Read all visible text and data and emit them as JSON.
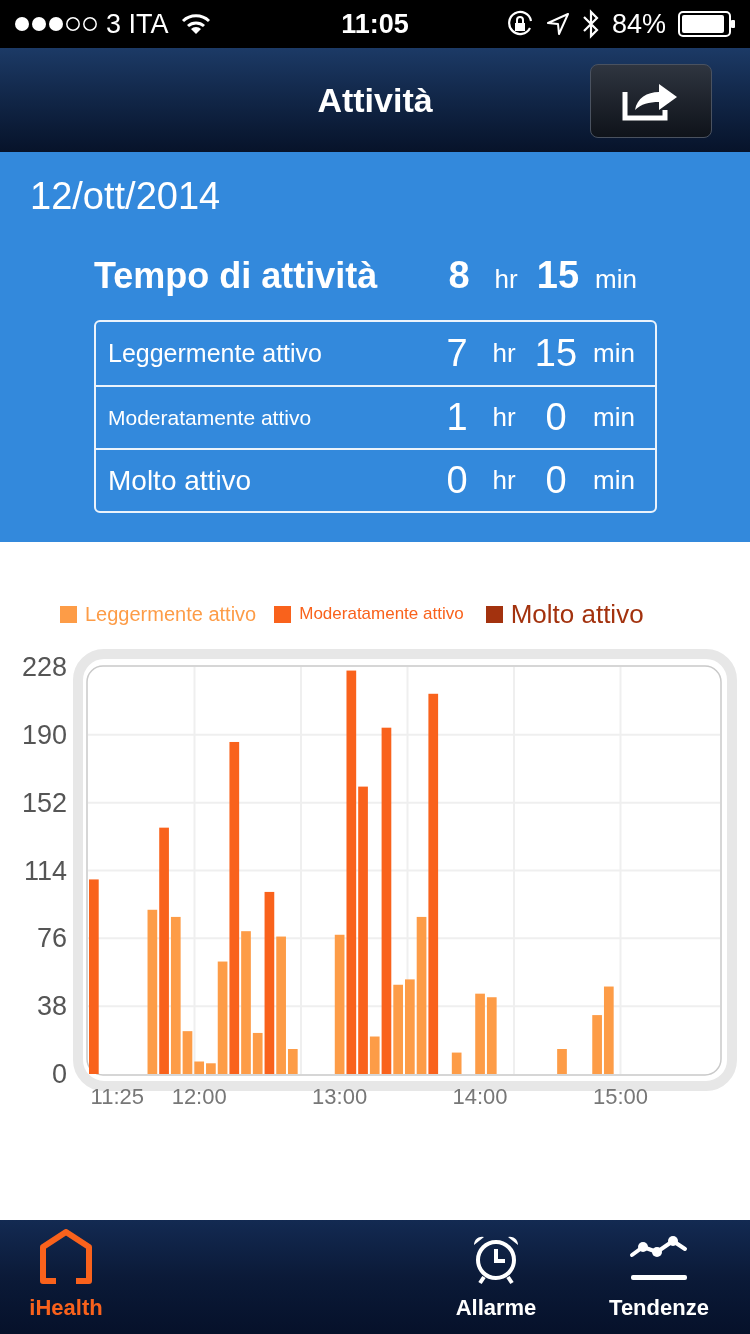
{
  "status_bar": {
    "carrier": "3 ITA",
    "time": "11:05",
    "battery": "84%"
  },
  "nav_bar": {
    "title": "Attività"
  },
  "date": "12/ott/2014",
  "summary": {
    "label": "Tempo di attività",
    "hours": "8",
    "hours_unit": "hr",
    "minutes": "15",
    "minutes_unit": "min"
  },
  "breakdown": [
    {
      "label": "Leggermente attivo",
      "hours": "7",
      "hours_unit": "hr",
      "minutes": "15",
      "minutes_unit": "min"
    },
    {
      "label": "Moderatamente attivo",
      "hours": "1",
      "hours_unit": "hr",
      "minutes": "0",
      "minutes_unit": "min"
    },
    {
      "label": "Molto attivo",
      "hours": "0",
      "hours_unit": "hr",
      "minutes": "0",
      "minutes_unit": "min"
    }
  ],
  "chart": {
    "chart_data": {
      "type": "bar",
      "stacked": true,
      "grid": true,
      "x": [
        675,
        680,
        685,
        690,
        695,
        700,
        705,
        710,
        715,
        720,
        725,
        730,
        735,
        740,
        745,
        750,
        755,
        760,
        765,
        770,
        775,
        780,
        785,
        790,
        795,
        800,
        805,
        810,
        815,
        820,
        825,
        830,
        835,
        840,
        845,
        850,
        855,
        860,
        865,
        870,
        875,
        880,
        885,
        890,
        895,
        900,
        905,
        910,
        915,
        920,
        925,
        930,
        935,
        940
      ],
      "xlim": [
        672.5,
        942.5
      ],
      "series": [
        {
          "name": "Leggermente attivo",
          "color": "#fd9c47",
          "values": [
            0,
            0,
            0,
            0,
            0,
            92,
            0,
            88,
            24,
            7,
            6,
            63,
            0,
            80,
            23,
            0,
            77,
            14,
            0,
            0,
            0,
            78,
            0,
            0,
            21,
            0,
            50,
            53,
            88,
            0,
            0,
            12,
            0,
            45,
            43,
            0,
            0,
            0,
            0,
            0,
            14,
            0,
            0,
            33,
            49,
            0,
            0,
            0,
            0,
            0,
            0,
            0,
            0,
            0
          ]
        },
        {
          "name": "Moderatamente attivo",
          "color": "#f9621c",
          "values": [
            109,
            0,
            0,
            0,
            0,
            0,
            138,
            0,
            0,
            0,
            0,
            0,
            186,
            0,
            0,
            102,
            0,
            0,
            0,
            0,
            0,
            0,
            226,
            161,
            0,
            194,
            0,
            0,
            0,
            213,
            0,
            0,
            0,
            0,
            0,
            0,
            0,
            0,
            0,
            0,
            0,
            0,
            0,
            0,
            0,
            0,
            0,
            0,
            0,
            0,
            0,
            0,
            0,
            0
          ]
        },
        {
          "name": "Molto attivo",
          "color": "#a3320e",
          "values": [
            0,
            0,
            0,
            0,
            0,
            0,
            0,
            0,
            0,
            0,
            0,
            0,
            0,
            0,
            0,
            0,
            0,
            0,
            0,
            0,
            0,
            0,
            0,
            0,
            0,
            0,
            0,
            0,
            0,
            0,
            0,
            0,
            0,
            0,
            0,
            0,
            0,
            0,
            0,
            0,
            0,
            0,
            0,
            0,
            0,
            0,
            0,
            0,
            0,
            0,
            0,
            0,
            0,
            0
          ]
        }
      ],
      "ylim": [
        0,
        228
      ],
      "yticks": [
        0,
        38,
        76,
        114,
        152,
        190,
        228
      ],
      "xticks": [
        {
          "value": 685,
          "label": "11:25"
        },
        {
          "value": 720,
          "label": "12:00"
        },
        {
          "value": 780,
          "label": "13:00"
        },
        {
          "value": 840,
          "label": "14:00"
        },
        {
          "value": 900,
          "label": "15:00"
        }
      ]
    }
  },
  "tab_bar": [
    {
      "label": "iHealth",
      "selected": true,
      "kind": "home"
    },
    {
      "label": "Allarme",
      "selected": false,
      "kind": "alarm"
    },
    {
      "label": "Tendenze",
      "selected": false,
      "kind": "trend"
    }
  ]
}
